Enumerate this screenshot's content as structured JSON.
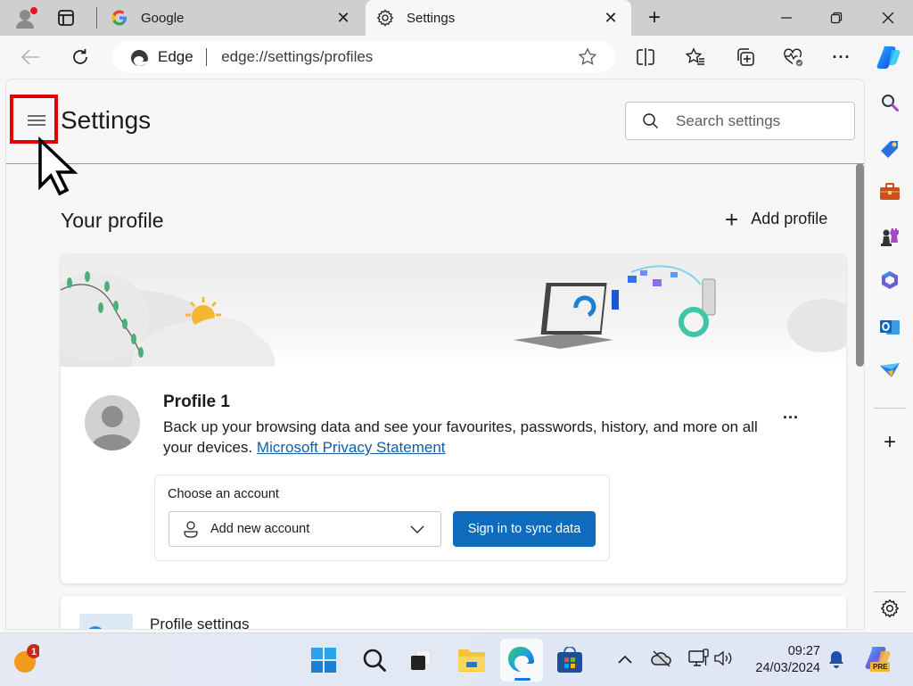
{
  "browser": {
    "tabs": [
      {
        "title": "Google",
        "icon": "google-icon",
        "active": false
      },
      {
        "title": "Settings",
        "icon": "gear-icon",
        "active": true
      }
    ],
    "address_bar": {
      "site_label": "Edge",
      "url": "edge://settings/profiles"
    },
    "window_controls": [
      "minimize",
      "restore",
      "close"
    ]
  },
  "settings": {
    "title": "Settings",
    "search_placeholder": "Search settings",
    "section_title": "Your profile",
    "add_profile_label": "Add profile",
    "profile": {
      "name": "Profile 1",
      "description": "Back up your browsing data and see your favourites, passwords, history, and more on all your devices.",
      "privacy_link": "Microsoft Privacy Statement",
      "more_label": "...",
      "choose_account_label": "Choose an account",
      "account_dropdown_value": "Add new account",
      "sign_in_label": "Sign in to sync data"
    },
    "next_card_title": "Profile settings"
  },
  "sidebar": {
    "items": [
      "search",
      "shopping",
      "tools",
      "games",
      "microsoft-365",
      "outlook",
      "drop"
    ],
    "add_label": "+",
    "settings_icon": "gear-icon"
  },
  "taskbar": {
    "weather_badge": "1",
    "time": "09:27",
    "date": "24/03/2024",
    "copilot_badge": "PRE"
  },
  "colors": {
    "accent": "#0f6cbd",
    "highlight": "#e00000",
    "link": "#115ea3"
  }
}
